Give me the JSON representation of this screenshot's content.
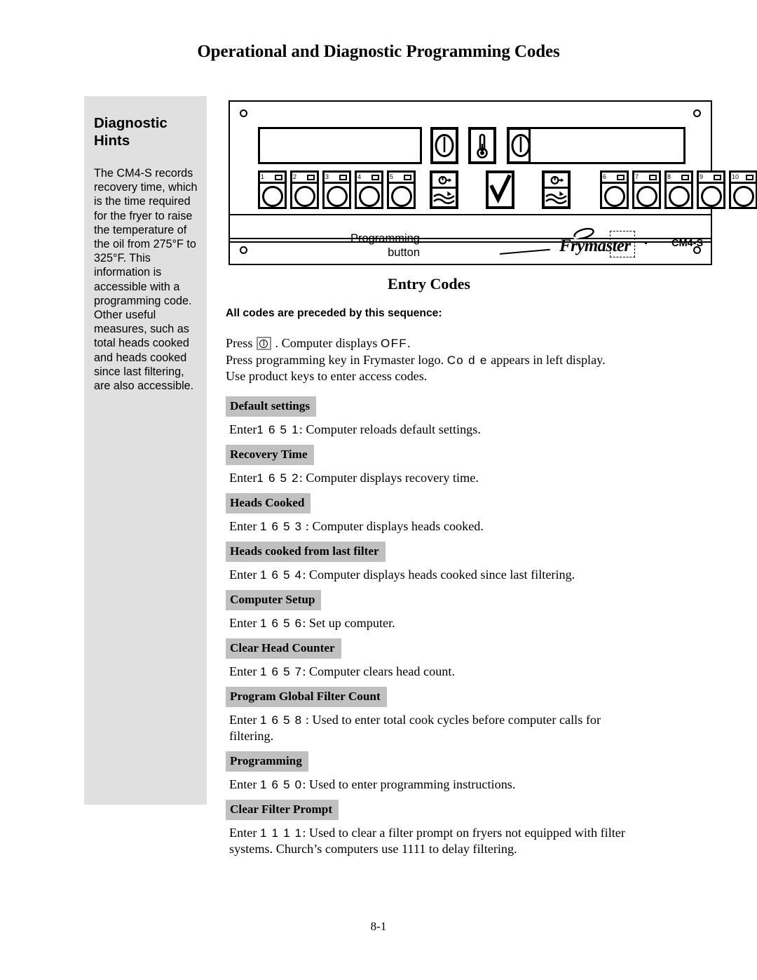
{
  "page": {
    "title": "Operational and Diagnostic Programming Codes",
    "footer": "8-1"
  },
  "sidebar": {
    "title": "Diagnostic Hints",
    "body": "The CM4-S records recovery time, which is the time required for the fryer to raise the temperature of the oil from 275°F to 325°F. This information is accessible with a programming code. Other useful measures, such as total heads cooked and heads cooked since last filtering, are also accessible."
  },
  "panel": {
    "programming_button_label": "Programming button",
    "brand": "Frymaster",
    "model": "CM4-S",
    "product_keys_left": [
      "1",
      "2",
      "3",
      "4",
      "5"
    ],
    "product_keys_right": [
      "6",
      "7",
      "8",
      "9",
      "10"
    ]
  },
  "main": {
    "section_heading": "Entry Codes",
    "lead": "All codes are preceded by this sequence:",
    "intro": {
      "press_prefix": "Press",
      "press_suffix": ". Computer displays",
      "off_display": "OFF",
      "off_period": ".",
      "line2_prefix": "Press programming key in Frymaster logo.",
      "code_display": "Co d e",
      "line2_suffix": "appears in left display.",
      "line3": "Use product keys to enter access codes."
    },
    "entries": [
      {
        "label": "Default settings",
        "pre": "Enter",
        "code": "1 6 5 1",
        "post": ":  Computer reloads default settings."
      },
      {
        "label": "Recovery Time",
        "pre": "Enter",
        "code": "1 6 5 2",
        "post": ": Computer displays recovery time."
      },
      {
        "label": "Heads Cooked",
        "pre": "Enter ",
        "code": "1 6 5 3",
        "post": " : Computer displays heads cooked."
      },
      {
        "label": "Heads cooked from last filter",
        "pre": "Enter ",
        "code": "1 6 5 4",
        "post": ": Computer displays heads cooked since last filtering."
      },
      {
        "label": "Computer Setup",
        "pre": "Enter ",
        "code": "1 6 5 6",
        "post": ": Set up computer."
      },
      {
        "label": "Clear Head Counter",
        "pre": "Enter ",
        "code": "1 6 5 7",
        "post": ": Computer clears head count."
      },
      {
        "label": "Program Global Filter Count",
        "pre": "Enter ",
        "code": "1 6 5 8",
        "post": " : Used to enter total cook cycles before computer calls for filtering."
      },
      {
        "label": "Programming",
        "pre": "Enter ",
        "code": "1 6 5 0",
        "post": ": Used to enter programming instructions."
      },
      {
        "label": "Clear Filter Prompt",
        "pre": "Enter ",
        "code": "1 1 1 1",
        "post": ": Used to clear a filter prompt on fryers not equipped with filter systems. Church’s computers use 1111 to delay filtering."
      }
    ]
  }
}
